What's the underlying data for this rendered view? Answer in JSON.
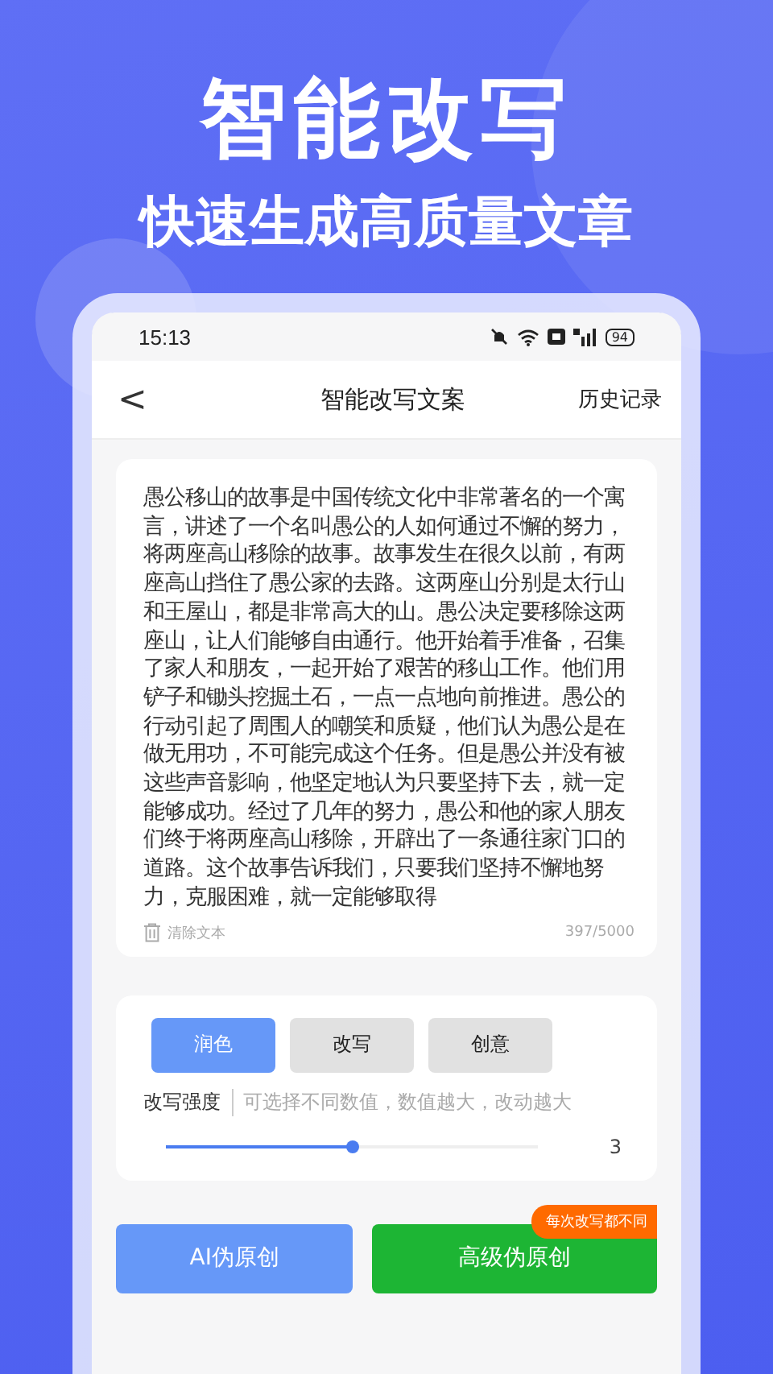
{
  "promo": {
    "title": "智能改写",
    "subtitle": "快速生成高质量文章"
  },
  "status_bar": {
    "time": "15:13",
    "battery": "94"
  },
  "header": {
    "back": "<",
    "title": "智能改写文案",
    "action": "历史记录"
  },
  "editor": {
    "text": "愚公移山的故事是中国传统文化中非常著名的一个寓言，讲述了一个名叫愚公的人如何通过不懈的努力，将两座高山移除的故事。故事发生在很久以前，有两座高山挡住了愚公家的去路。这两座山分别是太行山和王屋山，都是非常高大的山。愚公决定要移除这两座山，让人们能够自由通行。他开始着手准备，召集了家人和朋友，一起开始了艰苦的移山工作。他们用铲子和锄头挖掘土石，一点一点地向前推进。愚公的行动引起了周围人的嘲笑和质疑，他们认为愚公是在做无用功，不可能完成这个任务。但是愚公并没有被这些声音影响，他坚定地认为只要坚持下去，就一定能够成功。经过了几年的努力，愚公和他的家人朋友们终于将两座高山移除，开辟出了一条通往家门口的道路。这个故事告诉我们，只要我们坚持不懈地努力，克服困难，就一定能够取得",
    "clear": "清除文本",
    "count": "397/5000"
  },
  "modes": [
    {
      "label": "润色",
      "selected": true
    },
    {
      "label": "改写",
      "selected": false
    },
    {
      "label": "创意",
      "selected": false
    }
  ],
  "strength": {
    "label": "改写强度",
    "hint": "可选择不同数值，数值越大，改动越大",
    "level": 0.5,
    "value": "3"
  },
  "buttons": [
    {
      "label": "AI伪原创",
      "kind": "basic"
    },
    {
      "label": "高级伪原创",
      "kind": "advanced",
      "badge": "每次改写都不同"
    }
  ]
}
